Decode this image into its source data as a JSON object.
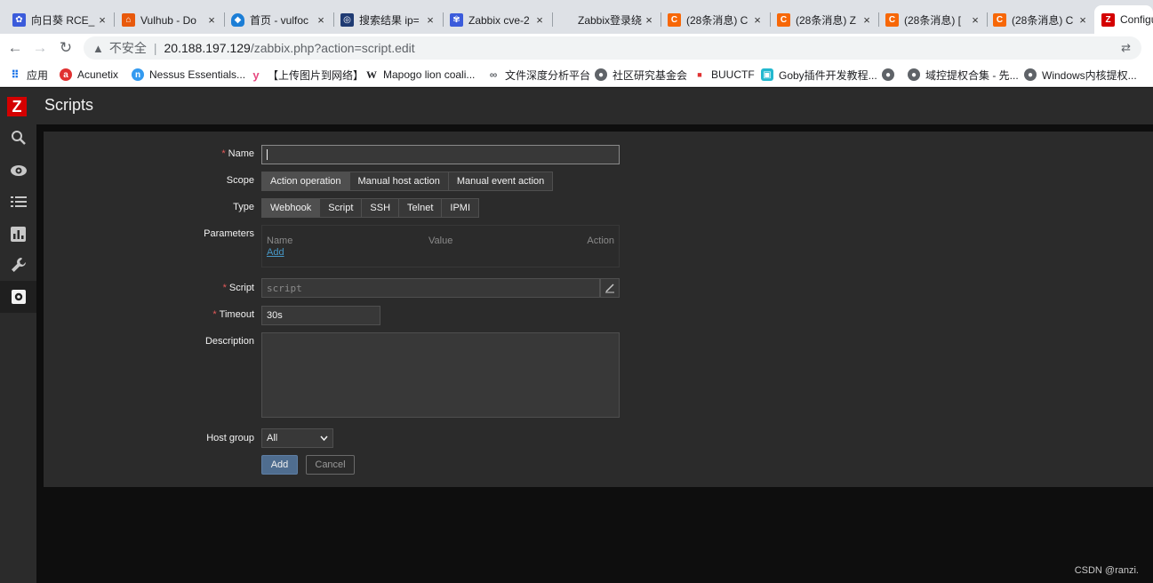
{
  "browser": {
    "tabs": [
      {
        "title": "向日葵 RCE_",
        "icon": "sunflower-icon"
      },
      {
        "title": "Vulhub - Do",
        "icon": "vulhub-icon"
      },
      {
        "title": "首页 - vulfoc",
        "icon": "shield-icon"
      },
      {
        "title": "搜索结果 ip=",
        "icon": "search-page-icon"
      },
      {
        "title": "Zabbix cve-2",
        "icon": "paw-icon"
      },
      {
        "title": "Zabbix登录绕",
        "icon": "blank-icon"
      },
      {
        "title": "(28条消息) C",
        "icon": "csdn-icon"
      },
      {
        "title": "(28条消息) Z",
        "icon": "csdn-icon"
      },
      {
        "title": "(28条消息) [",
        "icon": "csdn-icon"
      },
      {
        "title": "(28条消息) C",
        "icon": "csdn-icon"
      },
      {
        "title": "Configu",
        "icon": "zabbix-icon"
      }
    ],
    "close_glyph": "×",
    "security_label": "不安全",
    "url_host": "20.188.197.129",
    "url_path": "/zabbix.php?action=script.edit",
    "bookmarks": [
      {
        "label": "应用",
        "icon": "apps-grid-icon"
      },
      {
        "label": "Acunetix",
        "icon": "acunetix-icon"
      },
      {
        "label": "Nessus Essentials...",
        "icon": "nessus-icon"
      },
      {
        "label": "【上传图片到网络】",
        "icon": "y-icon"
      },
      {
        "label": "Mapogo lion coali...",
        "icon": "wikipedia-icon"
      },
      {
        "label": "文件深度分析平台",
        "icon": "link-icon"
      },
      {
        "label": "社区研究基金会",
        "icon": "globe-icon"
      },
      {
        "label": "BUUCTF",
        "icon": "buuctf-icon"
      },
      {
        "label": "Goby插件开发教程...",
        "icon": "bilibili-icon"
      },
      {
        "label": "",
        "icon": "globe-icon"
      },
      {
        "label": "域控提权合集 - 先...",
        "icon": "globe-icon"
      },
      {
        "label": "Windows内核提权...",
        "icon": "globe-icon"
      }
    ]
  },
  "sidebar": {
    "logo": "Z",
    "items": [
      "search-icon",
      "eye-icon",
      "list-icon",
      "chart-icon",
      "wrench-icon",
      "gear-icon"
    ]
  },
  "page": {
    "title": "Scripts"
  },
  "form": {
    "name_label": "Name",
    "name_value": "",
    "scope_label": "Scope",
    "scope_options": [
      "Action operation",
      "Manual host action",
      "Manual event action"
    ],
    "scope_selected": "Action operation",
    "type_label": "Type",
    "type_options": [
      "Webhook",
      "Script",
      "SSH",
      "Telnet",
      "IPMI"
    ],
    "type_selected": "Webhook",
    "parameters_label": "Parameters",
    "param_headers": [
      "Name",
      "Value",
      "Action"
    ],
    "add_param": "Add",
    "script_label": "Script",
    "script_placeholder": "script",
    "timeout_label": "Timeout",
    "timeout_value": "30s",
    "description_label": "Description",
    "description_value": "",
    "hostgroup_label": "Host group",
    "hostgroup_value": "All",
    "add_button": "Add",
    "cancel_button": "Cancel"
  },
  "colors": {
    "required": "#e45959",
    "link": "#4796c4",
    "logo_red": "#d40000",
    "primary_button": "#4f6d8f"
  },
  "watermark": "CSDN @ranzi."
}
